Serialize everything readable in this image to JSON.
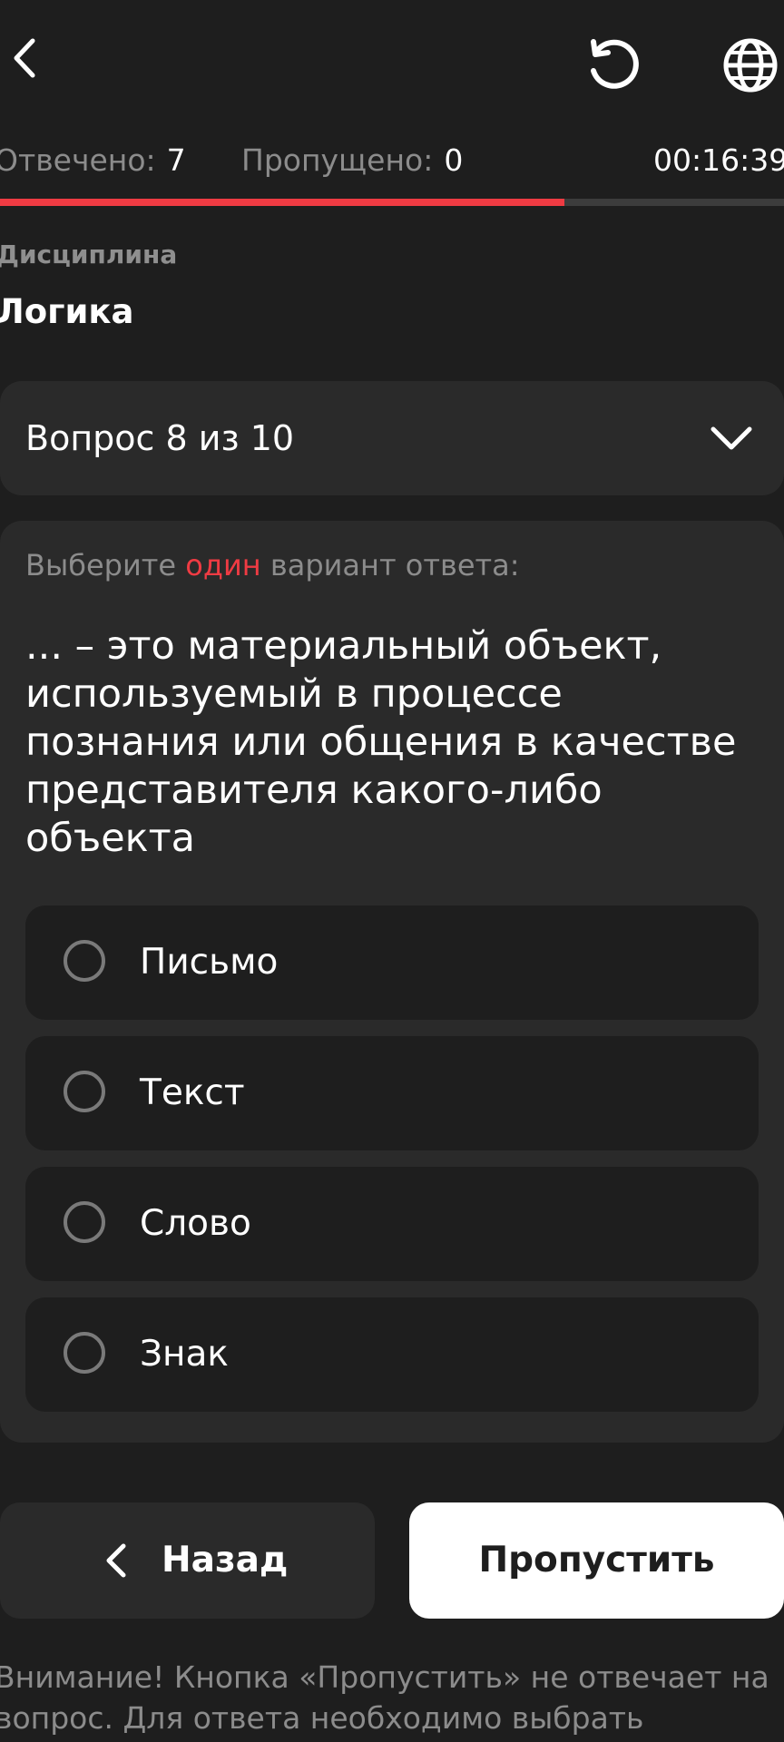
{
  "header": {
    "back_icon": "chevron-left-icon",
    "reload_icon": "reload-icon",
    "globe_icon": "globe-icon"
  },
  "stats": {
    "answered_label": "Отвечено:",
    "answered_value": "7",
    "skipped_label": "Пропущено:",
    "skipped_value": "0",
    "timer": "00:16:39"
  },
  "progress": {
    "fraction": 0.72
  },
  "discipline": {
    "label": "Дисциплина",
    "value": "Логика"
  },
  "question_selector": {
    "text": "Вопрос 8 из 10"
  },
  "question": {
    "instruction_before": "Выберите",
    "instruction_accent": "один",
    "instruction_after": "вариант ответа:",
    "text": "... – это материальный объект, используемый в процессе познания или общения в качестве представителя какого-либо объекта",
    "options": [
      {
        "label": "Письмо"
      },
      {
        "label": "Текст"
      },
      {
        "label": "Слово"
      },
      {
        "label": "Знак"
      }
    ]
  },
  "buttons": {
    "back_label": "Назад",
    "skip_label": "Пропустить"
  },
  "warning": "Внимание! Кнопка «Пропустить» не отвечает на вопрос. Для ответа необходимо выбрать",
  "colors": {
    "background": "#1e1e1e",
    "card": "#2a2a2a",
    "accent": "#ef3b43",
    "muted": "#8c8c8c"
  }
}
